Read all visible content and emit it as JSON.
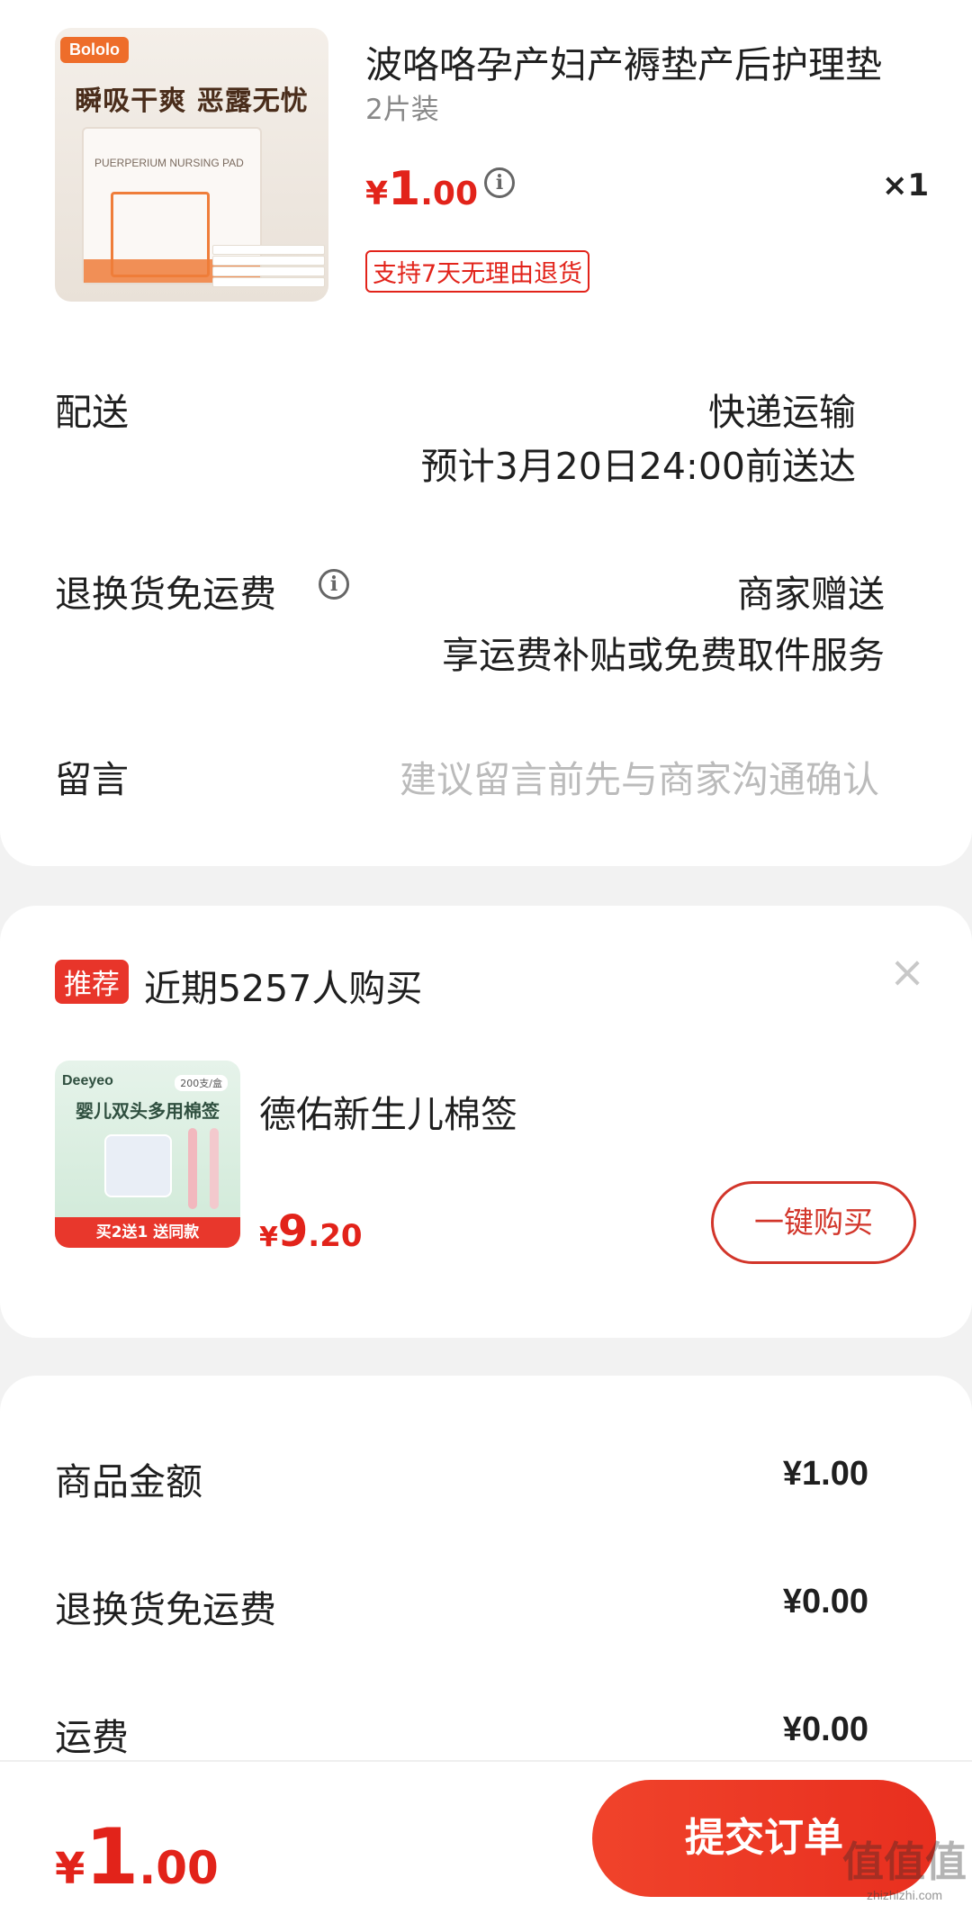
{
  "product": {
    "image_brand": "Bololo",
    "image_slogan": "瞬吸干爽 恶露无忧",
    "image_pkg_text": "PUERPERIUM NURSING PAD",
    "title": "波咯咯孕产妇产褥垫产后护理垫",
    "spec": "2片装",
    "price": {
      "currency": "¥",
      "integer": "1",
      "decimal": ".00"
    },
    "quantity": "×1",
    "return_badge": "支持7天无理由退货"
  },
  "delivery": {
    "label": "配送",
    "method": "快递运输",
    "eta": "预计3月20日24:00前送达"
  },
  "free_return": {
    "label": "退换货免运费",
    "value": "商家赠送",
    "desc": "享运费补贴或免费取件服务"
  },
  "message": {
    "label": "留言",
    "placeholder": "建议留言前先与商家沟通确认"
  },
  "recommend": {
    "tag": "推荐",
    "text": "近期5257人购买",
    "close": "×",
    "image_brand": "Deeyeo",
    "image_count": "200支/盒",
    "image_slogan": "婴儿双头多用棉签",
    "image_promo": "买2送1 送同款",
    "name": "德佑新生儿棉签",
    "price": {
      "currency": "¥",
      "integer": "9",
      "decimal": ".20"
    },
    "buy_label": "一键购买"
  },
  "summary": {
    "rows": [
      {
        "label": "商品金额",
        "value": "¥1.00"
      },
      {
        "label": "退换货免运费",
        "value": "¥0.00"
      },
      {
        "label": "运费",
        "value": "¥0.00"
      }
    ]
  },
  "footer": {
    "total": {
      "currency": "¥",
      "integer": "1",
      "decimal": ".00"
    },
    "submit_label": "提交订单"
  },
  "watermark": {
    "glyph": "值值值",
    "url": "zhizhizhi.com"
  },
  "colors": {
    "accent": "#e2231a",
    "button": "#e82f1f"
  }
}
